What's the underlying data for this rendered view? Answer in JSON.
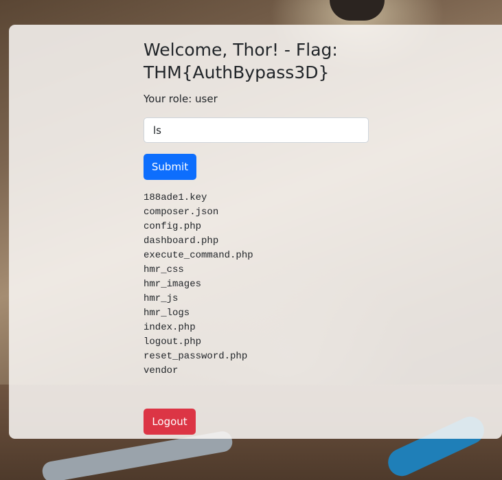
{
  "header": {
    "title": "Welcome, Thor! - Flag: THM{AuthBypass3D}",
    "role_text": "Your role: user"
  },
  "command": {
    "value": "ls",
    "submit_label": "Submit"
  },
  "output": {
    "lines": [
      "188ade1.key",
      "composer.json",
      "config.php",
      "dashboard.php",
      "execute_command.php",
      "hmr_css",
      "hmr_images",
      "hmr_js",
      "hmr_logs",
      "index.php",
      "logout.php",
      "reset_password.php",
      "vendor"
    ]
  },
  "actions": {
    "logout_label": "Logout"
  },
  "colors": {
    "primary": "#0d6efd",
    "danger": "#dc3545",
    "text": "#212529"
  }
}
